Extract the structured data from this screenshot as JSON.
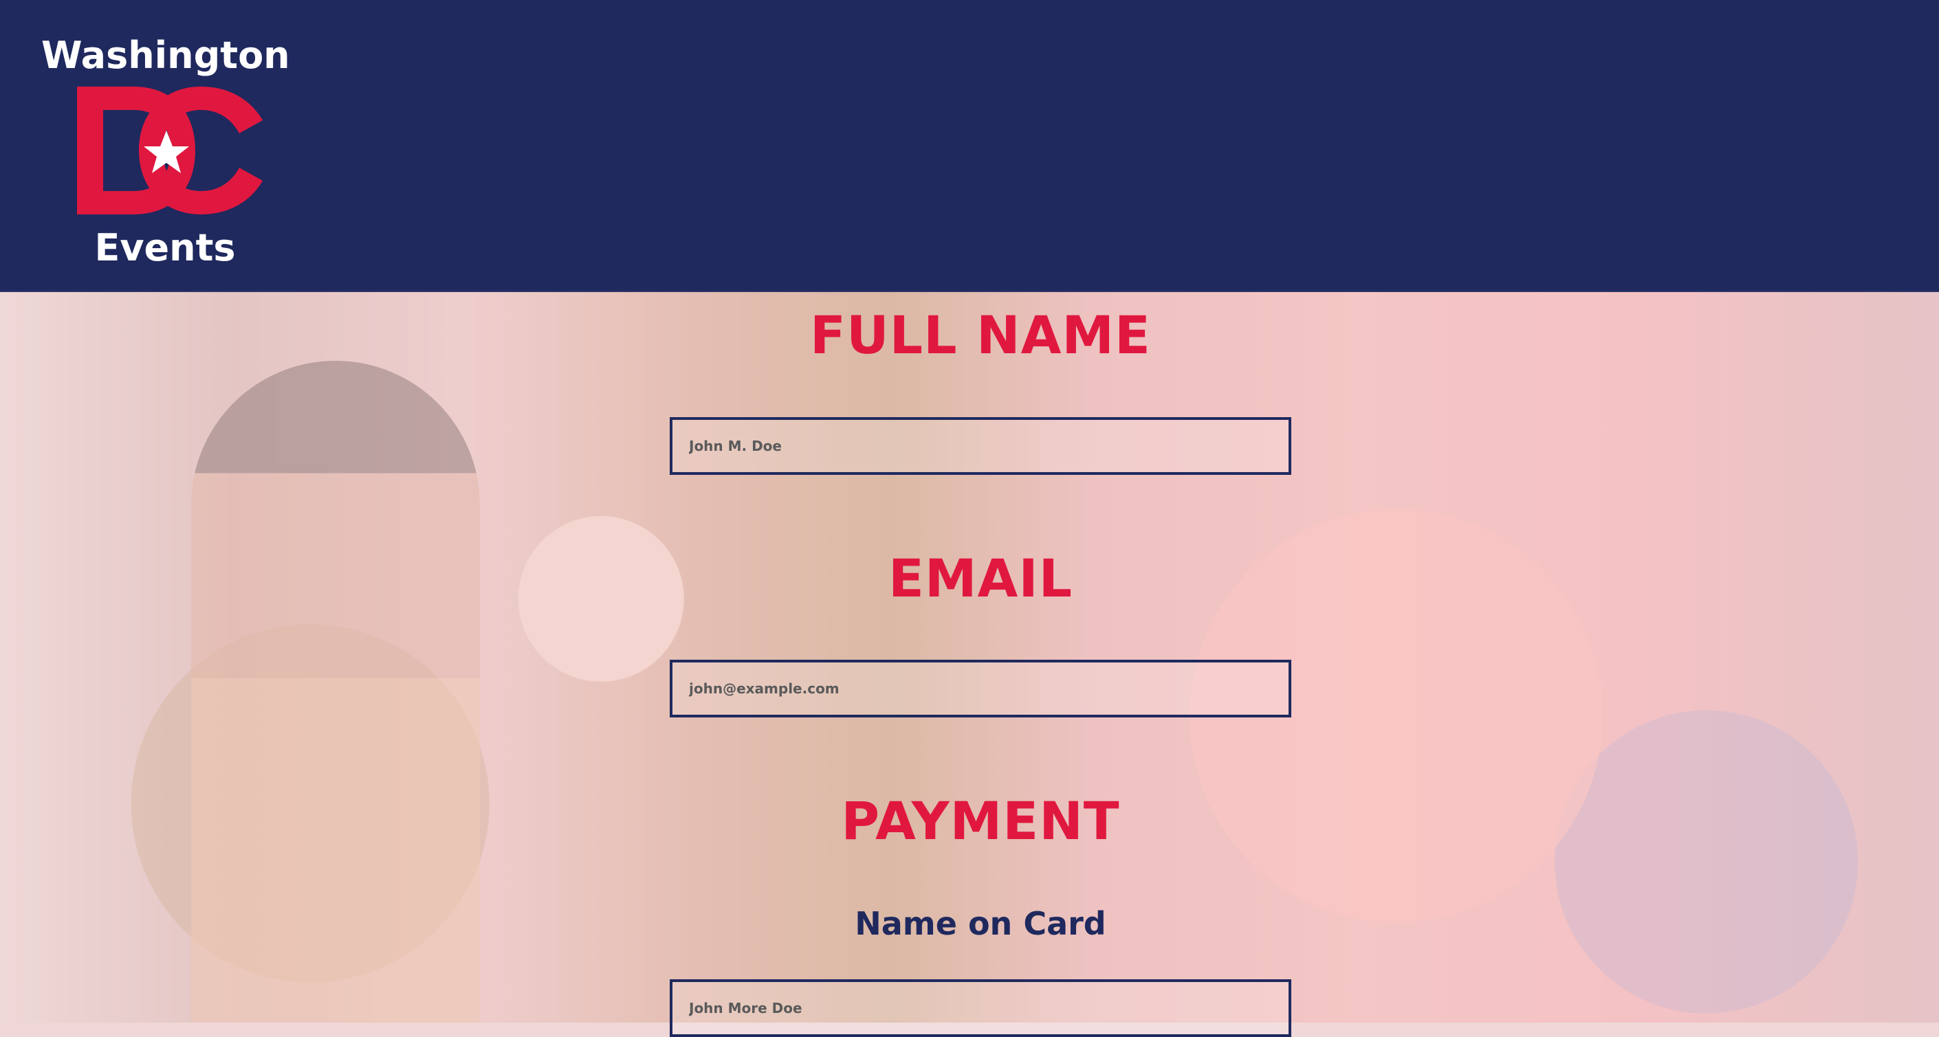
{
  "brand": {
    "top": "Washington",
    "mark": "DC",
    "bottom": "Events",
    "colors": {
      "navy": "#1f295e",
      "red": "#e0183f",
      "white": "#ffffff"
    }
  },
  "hero": {
    "image": "performance-photo"
  },
  "form": {
    "full_name": {
      "title": "FULL NAME",
      "placeholder": "John M. Doe"
    },
    "email": {
      "title": "EMAIL",
      "placeholder": "john@example.com"
    },
    "payment": {
      "title": "PAYMENT",
      "name_on_card_label": "Name on Card",
      "name_on_card_placeholder": "John More Doe"
    }
  }
}
